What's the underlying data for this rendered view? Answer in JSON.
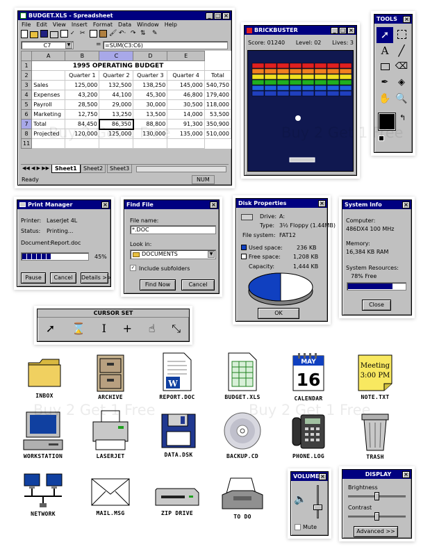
{
  "excel": {
    "title": "BUDGET.XLS - Spreadsheet",
    "menu": [
      "File",
      "Edit",
      "View",
      "Insert",
      "Format",
      "Data",
      "Window",
      "Help"
    ],
    "cell_ref": "C7",
    "formula": "=SUM(C3:C6)",
    "columns": [
      "",
      "A",
      "B",
      "C",
      "D",
      "E"
    ],
    "rows": [
      {
        "n": "1",
        "cells": [
          "1995 OPERATING BUDGET"
        ]
      },
      {
        "n": "2",
        "cells": [
          "",
          "Quarter 1",
          "Quarter 2",
          "Quarter 3",
          "Quarter 4",
          "Total"
        ]
      },
      {
        "n": "3",
        "cells": [
          "Sales",
          "125,000",
          "132,500",
          "138,250",
          "145,000",
          "540,750"
        ]
      },
      {
        "n": "4",
        "cells": [
          "Expenses",
          "43,200",
          "44,100",
          "45,300",
          "46,800",
          "179,400"
        ]
      },
      {
        "n": "5",
        "cells": [
          "Payroll",
          "28,500",
          "29,000",
          "30,000",
          "30,500",
          "118,000"
        ]
      },
      {
        "n": "6",
        "cells": [
          "Marketing",
          "12,750",
          "13,250",
          "13,500",
          "14,000",
          "53,500"
        ]
      },
      {
        "n": "7",
        "cells": [
          "Total",
          "84,450",
          "86,350",
          "88,800",
          "91,300",
          "350,900"
        ]
      },
      {
        "n": "8",
        "cells": [
          "Projected",
          "120,000",
          "125,000",
          "130,000",
          "135,000",
          "510,000"
        ]
      },
      {
        "n": "11",
        "cells": [
          "",
          "",
          "",
          "",
          "",
          ""
        ]
      }
    ],
    "sheets": [
      "Sheet1",
      "Sheet2",
      "Sheet3"
    ],
    "status_left": "Ready",
    "status_right": "NUM"
  },
  "brickbuster": {
    "title": "BRICKBUSTER",
    "score": "Score: 01240",
    "level": "Level: 02",
    "lives": "Lives: 3",
    "brick_colors": [
      "#e02020",
      "#f08020",
      "#f0e020",
      "#20b020",
      "#2060e0",
      "#2040c0"
    ]
  },
  "tools": {
    "title": "TOOLS",
    "swap": "↰"
  },
  "print_manager": {
    "title": "Print Manager",
    "printer_label": "Printer:",
    "printer": "LaserJet 4L",
    "status_label": "Status:",
    "status": "Printing...",
    "document_label": "Document:",
    "document": "Report.doc",
    "progress": 0.45,
    "progress_text": "45%",
    "buttons": [
      "Pause",
      "Cancel",
      "Details >>"
    ]
  },
  "find_file": {
    "title": "Find File",
    "name_label": "File name:",
    "name_value": "*.DOC",
    "look_label": "Look in:",
    "look_value": "DOCUMENTS",
    "subfolders": "Include subfolders",
    "buttons": [
      "Find Now",
      "Cancel"
    ]
  },
  "disk": {
    "title": "Disk Properties",
    "drive_label": "Drive:",
    "drive": "A:",
    "type_label": "Type:",
    "type": "3½ Floppy (1.44MB)",
    "fs_label": "File system:",
    "fs": "FAT12",
    "used_label": "Used space:",
    "used": "236 KB",
    "free_label": "Free space:",
    "free": "1,208 KB",
    "cap_label": "Capacity:",
    "cap": "1,444 KB",
    "ok": "OK"
  },
  "sysinfo": {
    "title": "System Info",
    "computer_label": "Computer:",
    "computer": "486DX4 100 MHz",
    "memory_label": "Memory:",
    "memory": "16,384 KB RAM",
    "res_label": "System Resources:",
    "res": "78% Free",
    "res_fraction": 0.78,
    "close": "Close"
  },
  "cursor_set": {
    "title": "CURSOR SET"
  },
  "icons": [
    {
      "label": "INBOX"
    },
    {
      "label": "ARCHIVE"
    },
    {
      "label": "REPORT.DOC"
    },
    {
      "label": "BUDGET.XLS"
    },
    {
      "label": "CALENDAR"
    },
    {
      "label": "NOTE.TXT"
    },
    {
      "label": "WORKSTATION"
    },
    {
      "label": "LASERJET"
    },
    {
      "label": "DATA.DSK"
    },
    {
      "label": "BACKUP.CD"
    },
    {
      "label": "PHONE.LOG"
    },
    {
      "label": "TRASH"
    },
    {
      "label": "NETWORK"
    },
    {
      "label": "MAIL.MSG"
    },
    {
      "label": "ZIP DRIVE"
    },
    {
      "label": "TO DO"
    }
  ],
  "calendar": {
    "month": "MAY",
    "day": "16"
  },
  "note": {
    "line1": "Meeting",
    "line2": "3:00 PM"
  },
  "volume": {
    "title": "VOLUME",
    "mute": "Mute"
  },
  "display": {
    "title": "DISPLAY",
    "brightness": "Brightness",
    "contrast": "Contrast",
    "advanced": "Advanced >>"
  },
  "watermark": "Buy 2 Get 1 Free"
}
